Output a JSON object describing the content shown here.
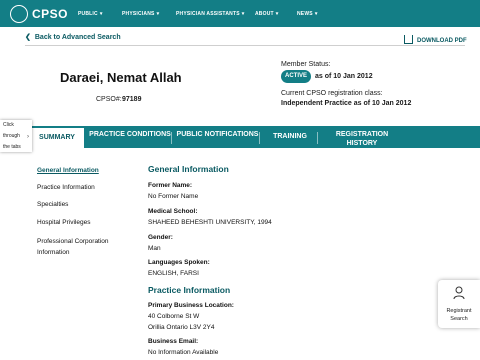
{
  "header": {
    "logo_text": "CPSO",
    "nav": [
      "PUBLIC",
      "PHYSICIANS",
      "PHYSICIAN ASSISTANTS",
      "ABOUT",
      "NEWS"
    ]
  },
  "actions": {
    "back_label": "Back to Advanced Search",
    "download_label": "DOWNLOAD PDF"
  },
  "profile": {
    "name": "Daraei, Nemat Allah",
    "cpso_label": "CPSO#:",
    "cpso_number": "97189",
    "member_status_label": "Member Status:",
    "status_badge": "ACTIVE",
    "status_as_of": "as of 10 Jan 2012",
    "reg_class_label": "Current CPSO registration class:",
    "reg_class_value": "Independent Practice as of 10 Jan 2012"
  },
  "hint": {
    "lines": [
      "Click",
      "through",
      "the tabs"
    ]
  },
  "tabs": [
    {
      "label": "SUMMARY"
    },
    {
      "label": "PRACTICE CONDITIONS"
    },
    {
      "label": "PUBLIC NOTIFICATIONS"
    },
    {
      "label": "TRAINING"
    },
    {
      "label": "REGISTRATION HISTORY"
    }
  ],
  "sidebar": [
    {
      "label": "General Information"
    },
    {
      "label": "Practice Information"
    },
    {
      "label": "Specialties"
    },
    {
      "label": "Hospital Privileges"
    },
    {
      "label": "Professional Corporation Information"
    }
  ],
  "general": {
    "title": "General Information",
    "former_name_label": "Former Name:",
    "former_name_value": "No Former Name",
    "medical_school_label": "Medical School:",
    "medical_school_value": "SHAHEED BEHESHTI UNIVERSITY, 1994",
    "gender_label": "Gender:",
    "gender_value": "Man",
    "languages_label": "Languages Spoken:",
    "languages_value": "ENGLISH, FARSI"
  },
  "practice": {
    "title": "Practice Information",
    "location_label": "Primary Business Location:",
    "address_line1": "40 Colborne St W",
    "address_line2": "Orillia Ontario L3V 2Y4",
    "email_label": "Business Email:",
    "email_value": "No Information Available"
  },
  "registrant_search": {
    "line1": "Registrant",
    "line2": "Search"
  }
}
